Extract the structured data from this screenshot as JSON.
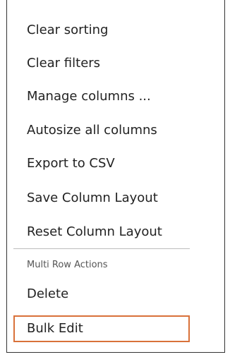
{
  "menu": {
    "items": [
      {
        "label": "Clear sorting"
      },
      {
        "label": "Clear filters"
      },
      {
        "label": "Manage columns ..."
      },
      {
        "label": "Autosize all columns"
      },
      {
        "label": "Export to CSV"
      },
      {
        "label": "Save Column Layout"
      },
      {
        "label": "Reset Column Layout"
      }
    ],
    "section_label": "Multi Row Actions",
    "section_items": [
      {
        "label": "Delete"
      },
      {
        "label": "Bulk Edit",
        "focused": true
      }
    ]
  },
  "colors": {
    "focus_border": "#d9713a",
    "text": "#222222",
    "divider": "#bdbdbd"
  }
}
